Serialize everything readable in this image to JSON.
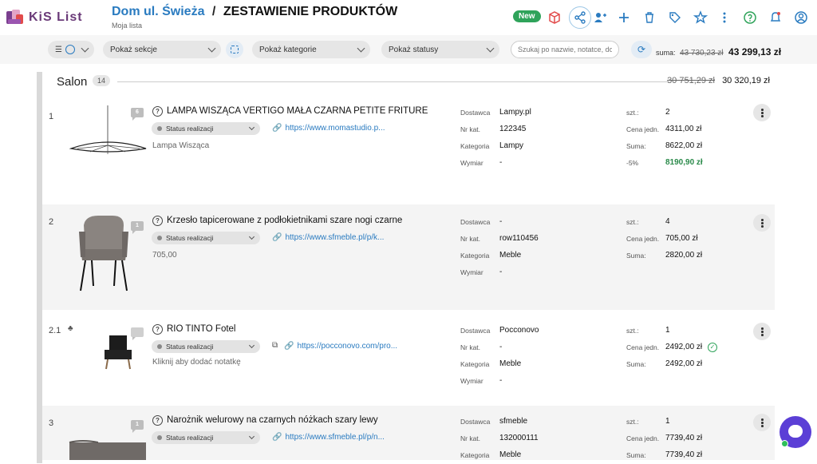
{
  "app": {
    "logo_text": "KiS List"
  },
  "header": {
    "project": "Dom ul. Świeża",
    "separator": "/",
    "page_title": "ZESTAWIENIE PRODUKTÓW",
    "subtitle": "Moja lista",
    "badge": "New",
    "icons": [
      "package-icon",
      "share-icon",
      "add-user-icon",
      "plus-icon",
      "trash-icon",
      "tag-icon",
      "star-icon",
      "more-vertical-icon",
      "help-icon",
      "notification-icon",
      "account-icon"
    ]
  },
  "filters": {
    "view_icons": [
      "list-icon",
      "clock-icon"
    ],
    "sections": "Pokaż sekcje",
    "categories": "Pokaż kategorie",
    "statuses": "Pokaż statusy",
    "search_placeholder": "Szukaj po nazwie, notatce, do",
    "sum_label": "suma:",
    "sum_old": "43 730,23 zł",
    "sum_new": "43 299,13 zł"
  },
  "section": {
    "name": "Salon",
    "count": "14",
    "sum_old": "30 751,29 zł",
    "sum_new": "30 320,19 zł"
  },
  "labels": {
    "supplier": "Dostawca",
    "catalog": "Nr kat.",
    "category": "Kategoria",
    "dimension": "Wymiar",
    "qty": "szt.:",
    "unit_price": "Cena jedn.",
    "total": "Suma:",
    "status": "Status realizacji"
  },
  "products": [
    {
      "num": "1",
      "comments": "6",
      "name": "LAMPA WISZĄCA VERTIGO MAŁA CZARNA PETITE FRITURE",
      "link": "https://www.momastudio.p...",
      "note": "Lampa Wisząca",
      "supplier": "Lampy.pl",
      "catalog": "122345",
      "category": "Lampy",
      "dimension": "-",
      "qty": "2",
      "unit_price": "4311,00 zł",
      "total": "8622,00 zł",
      "discount": "-5%",
      "discounted_total": "8190,90 zł"
    },
    {
      "num": "2",
      "comments": "1",
      "name": "Krzesło tapicerowane z podłokietnikami szare nogi czarne",
      "link": "https://www.sfmeble.pl/p/k...",
      "note": "705,00",
      "supplier": "-",
      "catalog": "row110456",
      "category": "Meble",
      "dimension": "-",
      "qty": "4",
      "unit_price": "705,00 zł",
      "total": "2820,00 zł"
    },
    {
      "num": "2.1",
      "comments": "",
      "name": "RIO TINTO Fotel",
      "link": "https://pocconovo.com/pro...",
      "note": "Kliknij aby dodać notatkę",
      "supplier": "Pocconovo",
      "catalog": "-",
      "category": "Meble",
      "dimension": "-",
      "qty": "1",
      "unit_price": "2492,00 zł",
      "total": "2492,00 zł"
    },
    {
      "num": "3",
      "comments": "1",
      "name": "Narożnik welurowy na czarnych nóżkach szary lewy",
      "link": "https://www.sfmeble.pl/p/n...",
      "note": "",
      "supplier": "sfmeble",
      "catalog": "132000111",
      "category": "Meble",
      "qty": "1",
      "unit_price": "7739,40 zł",
      "total": "7739,40 zł"
    }
  ],
  "colors": {
    "accent": "#2a7bc0",
    "new_badge": "#2fa35a",
    "discount": "#2a8a4a",
    "chat": "#5b3fd6"
  }
}
